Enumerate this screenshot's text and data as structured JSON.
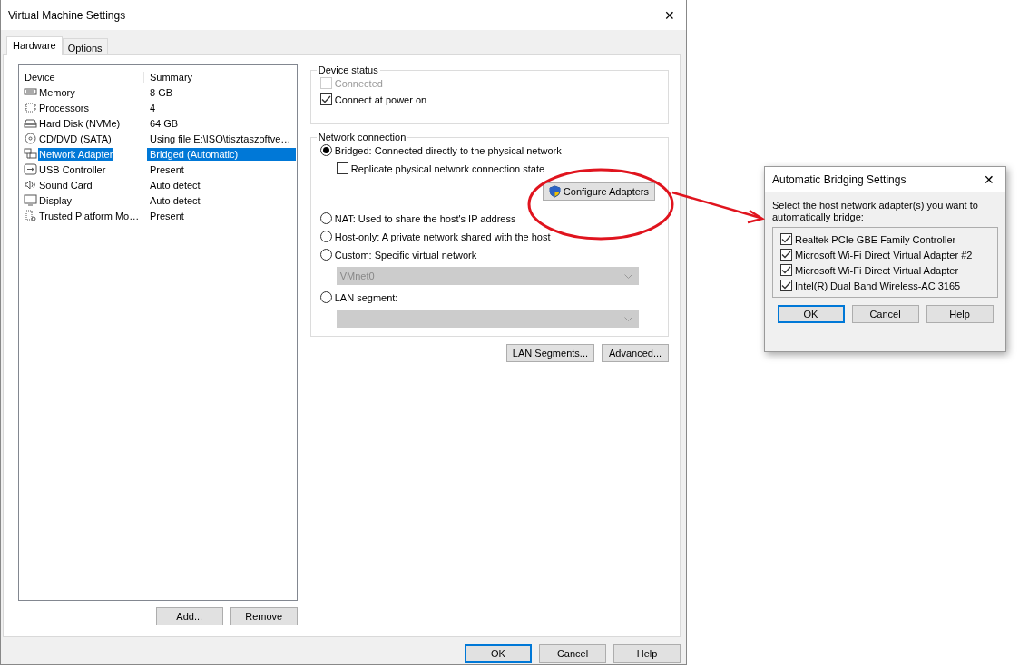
{
  "window": {
    "title": "Virtual Machine Settings",
    "close": "✕"
  },
  "tabs": [
    {
      "label": "Hardware",
      "selected": true
    },
    {
      "label": "Options",
      "selected": false
    }
  ],
  "device_table": {
    "columns": [
      "Device",
      "Summary"
    ],
    "rows": [
      {
        "kind": "memory",
        "device": "Memory",
        "summary": "8 GB",
        "selected": false
      },
      {
        "kind": "processor",
        "device": "Processors",
        "summary": "4",
        "selected": false
      },
      {
        "kind": "disk",
        "device": "Hard Disk (NVMe)",
        "summary": "64 GB",
        "selected": false
      },
      {
        "kind": "cd",
        "device": "CD/DVD (SATA)",
        "summary": "Using file E:\\ISO\\tisztaszoftve…",
        "selected": false
      },
      {
        "kind": "network",
        "device": "Network Adapter",
        "summary": "Bridged (Automatic)",
        "selected": true
      },
      {
        "kind": "usb",
        "device": "USB Controller",
        "summary": "Present",
        "selected": false
      },
      {
        "kind": "sound",
        "device": "Sound Card",
        "summary": "Auto detect",
        "selected": false
      },
      {
        "kind": "display",
        "device": "Display",
        "summary": "Auto detect",
        "selected": false
      },
      {
        "kind": "tpm",
        "device": "Trusted Platform Mo…",
        "summary": "Present",
        "selected": false
      }
    ]
  },
  "list_buttons": [
    "Add...",
    "Remove"
  ],
  "device_status": {
    "title": "Device status",
    "options": [
      {
        "label": "Connected",
        "checked": false,
        "disabled": true
      },
      {
        "label": "Connect at power on",
        "checked": true,
        "disabled": false
      }
    ]
  },
  "network_connection": {
    "title": "Network connection",
    "bridged": {
      "label": "Bridged: Connected directly to the physical network",
      "selected": true
    },
    "replicate": {
      "label": "Replicate physical network connection state",
      "checked": false
    },
    "configure_button": "Configure Adapters",
    "nat": {
      "label": "NAT: Used to share the host's IP address",
      "selected": false
    },
    "host_only": {
      "label": "Host-only: A private network shared with the host",
      "selected": false
    },
    "custom": {
      "label": "Custom: Specific virtual network",
      "selected": false
    },
    "custom_select": {
      "value": "VMnet0",
      "disabled": true
    },
    "lan_segment": {
      "label": "LAN segment:",
      "selected": false
    },
    "lan_select": {
      "disabled": true
    }
  },
  "panel_buttons": [
    "LAN Segments...",
    "Advanced..."
  ],
  "footer_buttons": [
    {
      "label": "OK",
      "default": true
    },
    {
      "label": "Cancel",
      "default": false
    },
    {
      "label": "Help",
      "default": false
    }
  ],
  "bridging_dialog": {
    "title": "Automatic Bridging Settings",
    "close": "✕",
    "prompt": "Select the host network adapter(s) you want to automatically bridge:",
    "adapters": [
      {
        "label": "Realtek PCIe GBE Family Controller",
        "checked": true
      },
      {
        "label": "Microsoft Wi-Fi Direct Virtual Adapter #2",
        "checked": true
      },
      {
        "label": "Microsoft Wi-Fi Direct Virtual Adapter",
        "checked": true
      },
      {
        "label": "Intel(R) Dual Band Wireless-AC 3165",
        "checked": true
      }
    ],
    "buttons": [
      {
        "label": "OK",
        "default": true
      },
      {
        "label": "Cancel",
        "default": false
      },
      {
        "label": "Help",
        "default": false
      }
    ]
  }
}
